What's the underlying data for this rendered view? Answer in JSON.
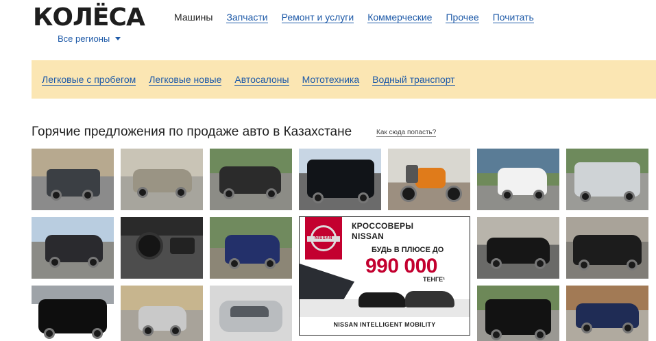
{
  "header": {
    "logo_text": "КОЛЁСА",
    "region_label": "Все регионы"
  },
  "top_nav": [
    {
      "label": "Машины",
      "active": true
    },
    {
      "label": "Запчасти",
      "active": false
    },
    {
      "label": "Ремонт и услуги",
      "active": false
    },
    {
      "label": "Коммерческие",
      "active": false
    },
    {
      "label": "Прочее",
      "active": false
    },
    {
      "label": "Почитать",
      "active": false
    }
  ],
  "sub_nav": [
    {
      "label": "Легковые с пробегом"
    },
    {
      "label": "Легковые новые"
    },
    {
      "label": "Автосалоны"
    },
    {
      "label": "Мототехника"
    },
    {
      "label": "Водный транспорт"
    }
  ],
  "hot": {
    "title": "Горячие предложения по продаже авто в Казахстане",
    "help_link": "Как сюда попасть?"
  },
  "ad": {
    "line1": "КРОССОВЕРЫ",
    "line2": "NISSAN",
    "line3": "БУДЬ В ПЛЮСЕ ДО",
    "amount": "990 000",
    "currency": "ТЕНГЕ¹",
    "logo_text": "NISSAN",
    "footer": "NISSAN INTELLIGENT MOBILITY"
  },
  "colors": {
    "link": "#1e5aa8",
    "subnav_bg": "#fbe6b3",
    "brand_red": "#c3002f"
  }
}
